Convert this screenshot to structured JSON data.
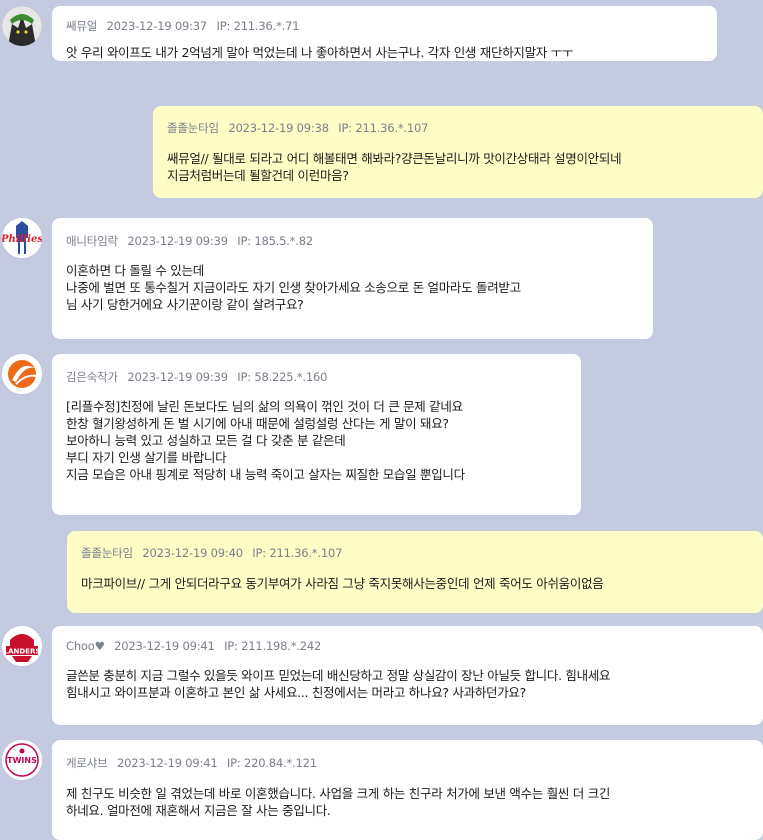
{
  "comments": [
    {
      "nick": "쌔뮤얼",
      "time": "2023-12-19 09:37",
      "ip": "IP: 211.36.*.71",
      "lines": [
        "앗 우리 와이프도 내가 2억넘게 말아 먹었는데 나 좋아하면서 사는구나. 각자 인생 재단하지말자 ㅜㅜ"
      ]
    },
    {
      "nick": "졸졸눈타임",
      "time": "2023-12-19 09:38",
      "ip": "IP: 211.36.*.107",
      "lines": [
        "쌔뮤얼// 될대로 되라고 어디 해볼태면 해봐라?걍큰돈날리니까 맛이간상태라 설명이안되네",
        "지금처럼버는데 될할건데 이런마음?"
      ]
    },
    {
      "nick": "애니타임락",
      "time": "2023-12-19 09:39",
      "ip": "IP: 185.5.*.82",
      "avatar_text": "Phillies",
      "lines": [
        "이혼하면 다 돌릴 수 있는데",
        "나중에 벌면 또 통수칠거 지금이라도 자기 인생 찾아가세요 소송으로 돈 얼마라도 돌려받고",
        "님 사기 당한거에요 사기꾼이랑 같이 살려구요?"
      ]
    },
    {
      "nick": "김은숙작가",
      "time": "2023-12-19 09:39",
      "ip": "IP: 58.225.*.160",
      "lines": [
        "[리플수정]친정에 날린 돈보다도 님의 삶의 의욕이 꺾인 것이 더 큰 문제 같네요",
        "한창 혈기왕성하게 돈 벌 시기에 아내 때문에 설렁설렁 산다는 게 말이 돼요?",
        "보아하니 능력 있고 성실하고 모든 걸 다 갖춘 분 같은데",
        "부디 자기 인생 살기를 바랍니다",
        "지금 모습은 아내 핑계로 적당히 내 능력 죽이고 살자는 찌질한 모습일 뿐입니다"
      ]
    },
    {
      "nick": "졸졸눈타임",
      "time": "2023-12-19 09:40",
      "ip": "IP: 211.36.*.107",
      "lines": [
        "마크파이브// 그게 안되더라구요 동기부여가 사라짐 그냥 죽지못해사는중인데 언제 죽어도 아쉬움이없음"
      ]
    },
    {
      "nick": "Choo♥",
      "time": "2023-12-19 09:41",
      "ip": "IP: 211.198.*.242",
      "avatar_text": "LANDERS",
      "lines": [
        "글쓴분 충분히 지금 그럴수 있을듯 와이프 믿었는데 배신당하고 정말 상실감이 장난 아닐듯 합니다. 힘내세요",
        "힘내시고 와이프분과 이혼하고 본인 삶 사세요... 친정에서는 머라고 하나요? 사과하던가요?"
      ]
    },
    {
      "nick": "게로샤브",
      "time": "2023-12-19 09:41",
      "ip": "IP: 220.84.*.121",
      "avatar_text": "TWINS",
      "lines": [
        "제 친구도 비슷한 일 겪었는데 바로 이혼했습니다. 사업을 크게 하는 친구라 처가에 보낸 액수는 훨씬 더 크긴",
        "하네요. 얼마전에 재혼해서 지금은 잘 사는 중입니다."
      ]
    }
  ],
  "colors": {
    "background": "#c4cbe0",
    "bubble_white": "#ffffff",
    "bubble_yellow": "#fdfdc5"
  }
}
